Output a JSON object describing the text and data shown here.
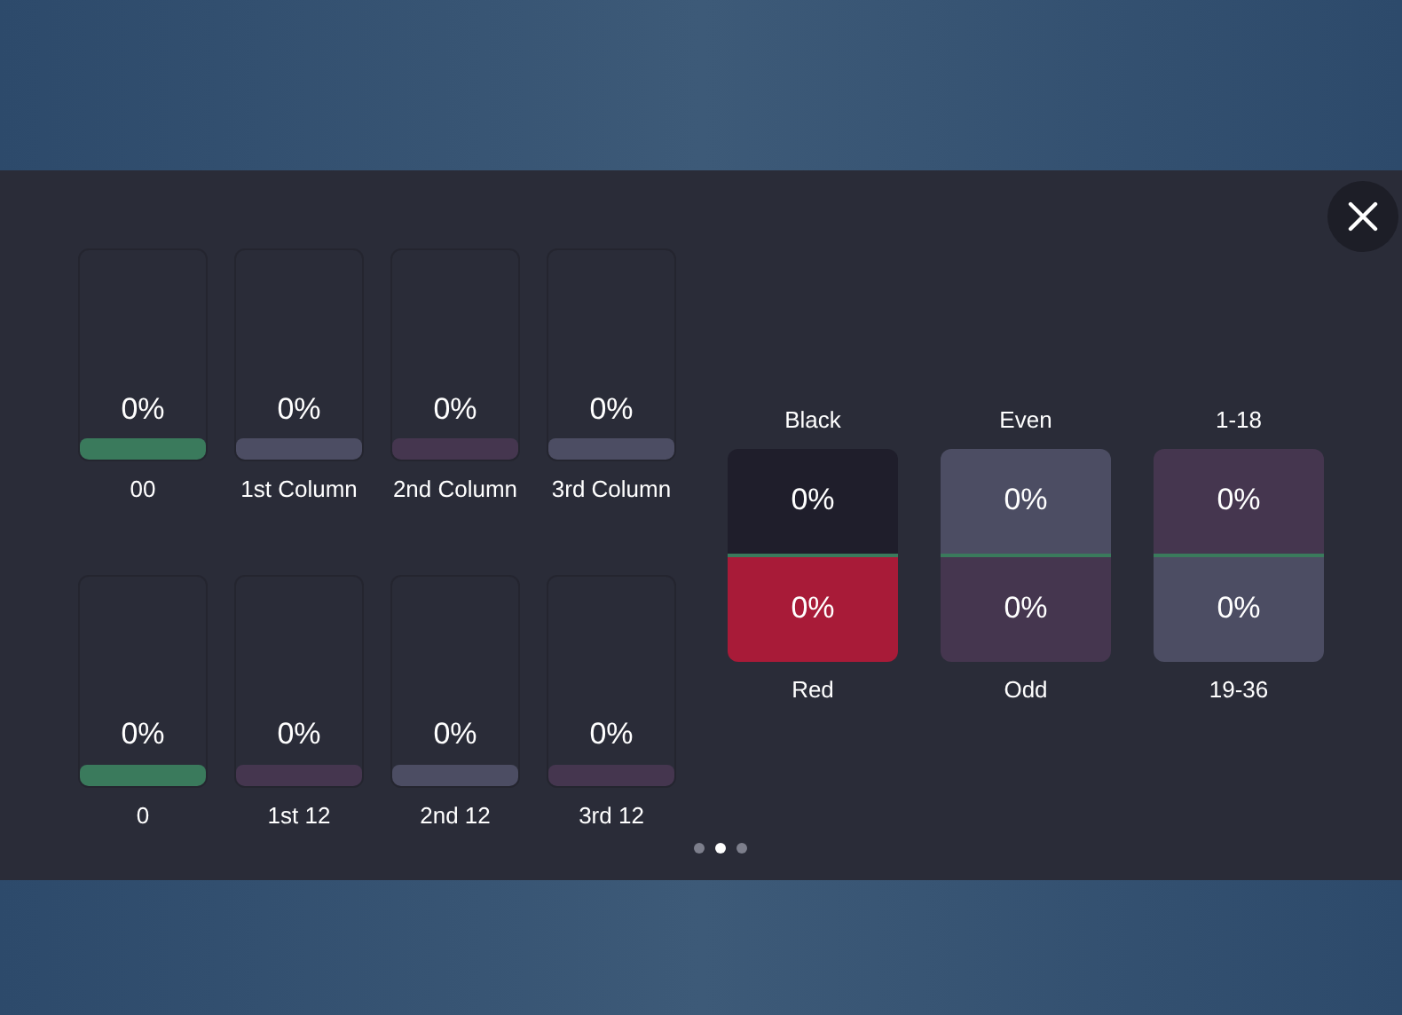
{
  "columns": [
    {
      "label": "00",
      "percent": "0%",
      "color": "#3a7a5c"
    },
    {
      "label": "1st Column",
      "percent": "0%",
      "color": "#4c4d63"
    },
    {
      "label": "2nd Column",
      "percent": "0%",
      "color": "#45364f"
    },
    {
      "label": "3rd Column",
      "percent": "0%",
      "color": "#4c4d63"
    },
    {
      "label": "0",
      "percent": "0%",
      "color": "#3a7a5c"
    },
    {
      "label": "1st 12",
      "percent": "0%",
      "color": "#45364f"
    },
    {
      "label": "2nd 12",
      "percent": "0%",
      "color": "#4c4d63"
    },
    {
      "label": "3rd 12",
      "percent": "0%",
      "color": "#45364f"
    }
  ],
  "pairs": [
    {
      "top_label": "Black",
      "bottom_label": "Red",
      "top": {
        "percent": "0%",
        "color": "#1f1e2b"
      },
      "bottom": {
        "percent": "0%",
        "color": "#a81b38"
      }
    },
    {
      "top_label": "Even",
      "bottom_label": "Odd",
      "top": {
        "percent": "0%",
        "color": "#4c4d63"
      },
      "bottom": {
        "percent": "0%",
        "color": "#45364f"
      }
    },
    {
      "top_label": "1-18",
      "bottom_label": "19-36",
      "top": {
        "percent": "0%",
        "color": "#45364f"
      },
      "bottom": {
        "percent": "0%",
        "color": "#4c4d63"
      }
    }
  ],
  "pager": [
    {
      "selected": false
    },
    {
      "selected": true
    },
    {
      "selected": false
    }
  ]
}
